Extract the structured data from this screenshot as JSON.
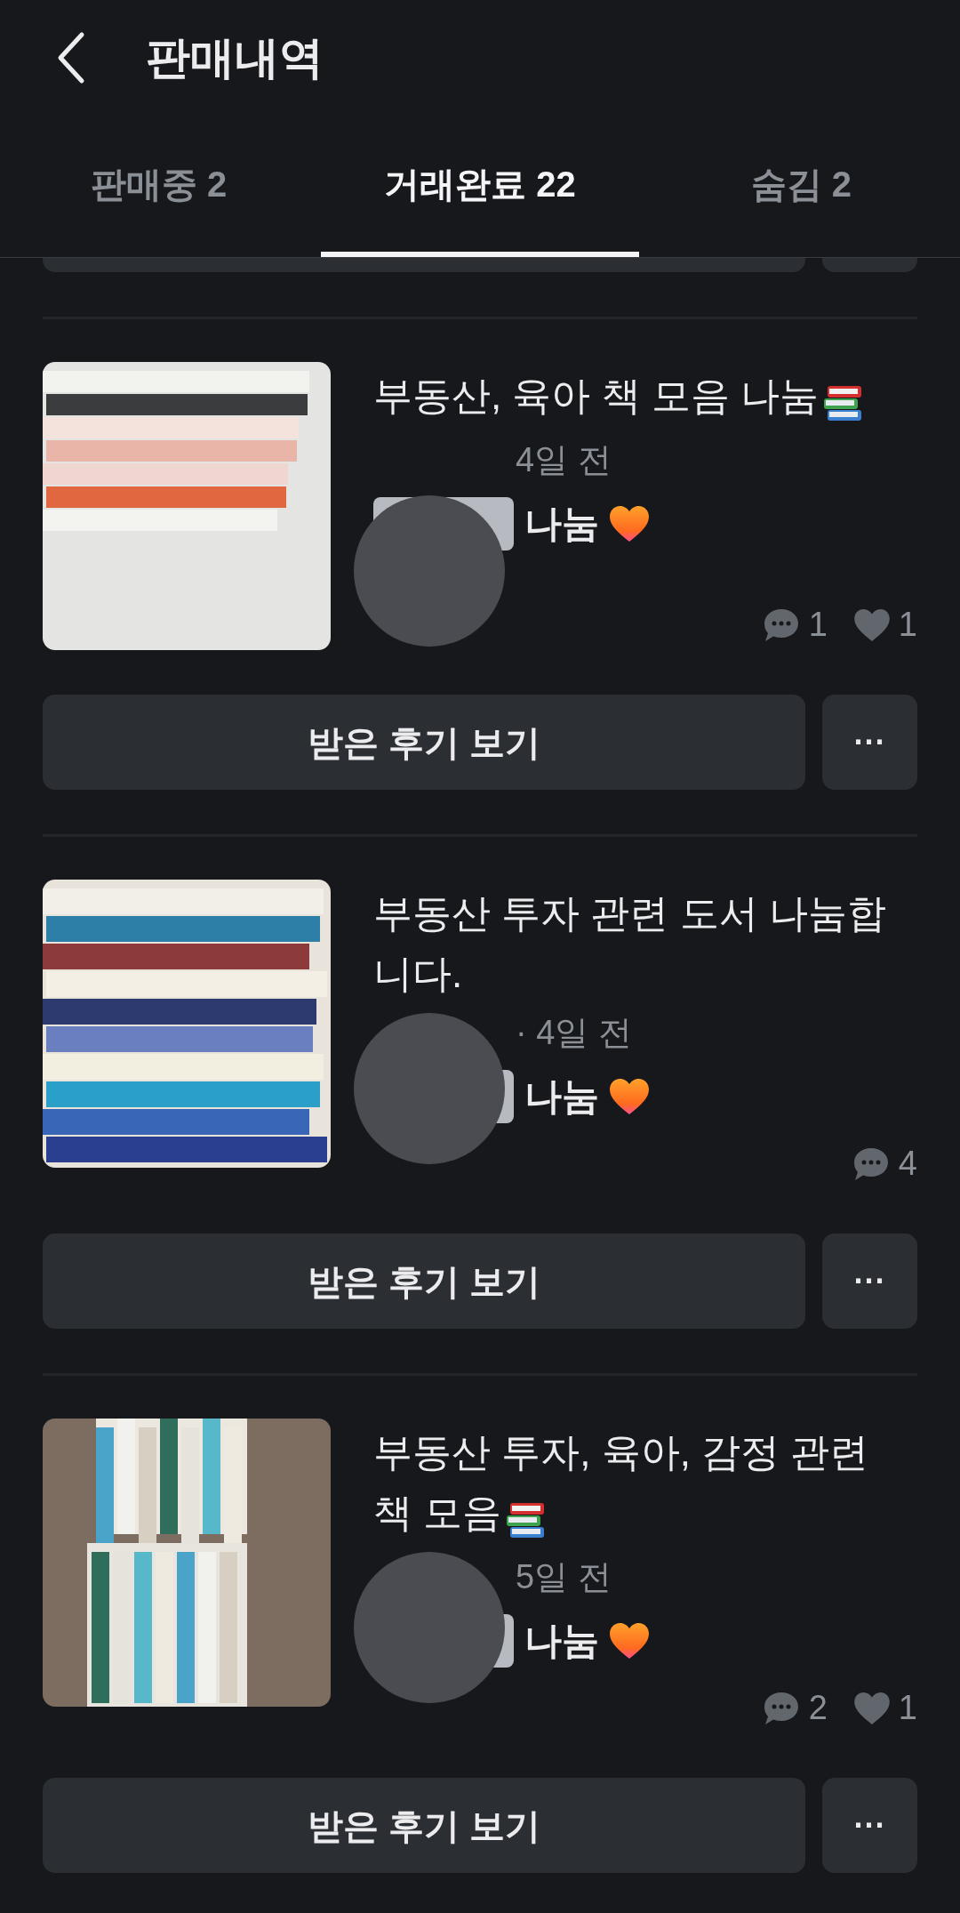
{
  "header": {
    "title": "판매내역"
  },
  "tabs": [
    {
      "label": "판매중 2",
      "selected": false
    },
    {
      "label": "거래완료 22",
      "selected": true
    },
    {
      "label": "숨김 2",
      "selected": false
    }
  ],
  "items": [
    {
      "kind": "picture",
      "title": "부동산, 육아 책 모음 나눔",
      "meta": "4일 전",
      "price": "나눔",
      "comments": "1",
      "likes": "1",
      "review_button": "받은 후기 보기",
      "more_button": "···"
    },
    {
      "kind": "picture",
      "title": "부동산 투자 관련 도서 나눔합니다.",
      "meta": "· 4일 전",
      "price": "나눔",
      "comments": "4",
      "review_button": "받은 후기 보기",
      "more_button": "···"
    },
    {
      "kind": "picture",
      "title": "부동산 투자, 육아, 감정 관련 책 모음",
      "meta": "5일 전",
      "price": "나눔",
      "comments": "2",
      "likes": "1",
      "review_button": "받은 후기 보기",
      "more_button": "···"
    }
  ]
}
